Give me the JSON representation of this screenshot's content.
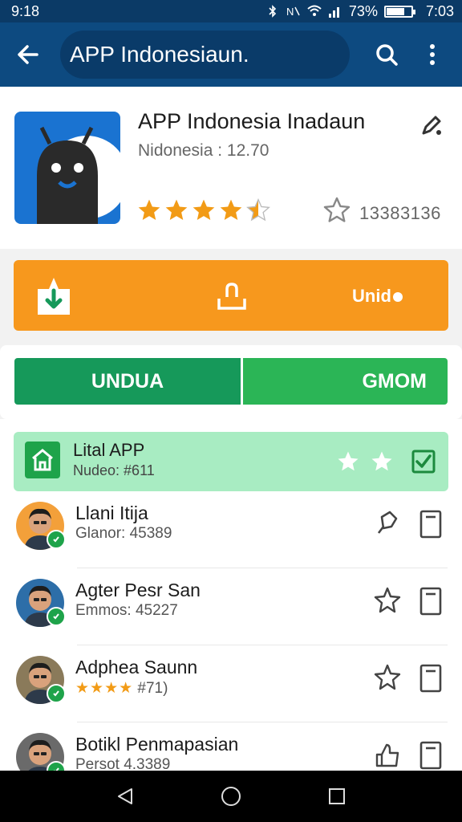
{
  "status_bar": {
    "time_left": "9:18",
    "battery_text": "73%",
    "time_right": "7:03",
    "battery_level": 0.73
  },
  "app_bar": {
    "title": "APP Indonesiaun.",
    "back_icon": "arrow-left-icon",
    "search_icon": "search-icon",
    "more_icon": "more-vert-icon"
  },
  "app": {
    "name": "APP Indonesia Inadaun",
    "subtitle": "Nidonesia : 12.70",
    "rating": 4.5,
    "rating_max": 5,
    "count": "13383136",
    "icon_colors": {
      "bg": "#1a73d1",
      "figure": "#2a2a2a"
    }
  },
  "actions": {
    "orange_label": "Unid",
    "download_icon": "download-box-icon",
    "share_icon": "share-icon"
  },
  "split_buttons": {
    "left": "UNDUA",
    "right": "GMOM"
  },
  "highlight_item": {
    "title": "Lital APP",
    "subtitle": "Nudeo: #611",
    "icon": "home-icon",
    "stars": 2,
    "checked": true
  },
  "list": [
    {
      "name": "Llani Itija",
      "sub": "Glanor: 45389",
      "pin_icon": "pin-icon",
      "doc_icon": "document-icon"
    },
    {
      "name": "Agter Pesr San",
      "sub": "Emmos: 45227",
      "pin_icon": "star-outline-icon",
      "doc_icon": "document-icon"
    },
    {
      "name": "Adphea Saunn",
      "sub_stars": "★★★★",
      "sub": "#71)",
      "pin_icon": "star-outline-icon",
      "doc_icon": "document-icon"
    },
    {
      "name": "Botikl Penmapasian",
      "sub": "Persot 4.3389",
      "pin_icon": "thumb-up-icon",
      "doc_icon": "document-icon"
    }
  ],
  "colors": {
    "app_bar": "#0d4a80",
    "orange": "#f7981d",
    "green_dark": "#16995a",
    "green_light": "#2bb556",
    "highlight": "#a8ecc2",
    "star": "#f29b16"
  }
}
